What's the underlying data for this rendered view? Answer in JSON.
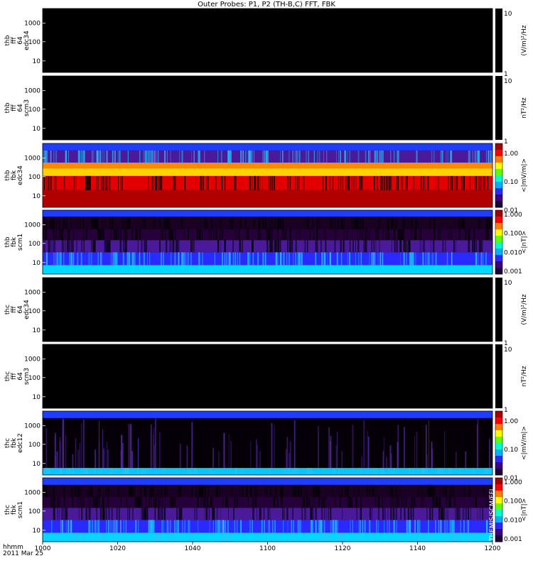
{
  "title": "Outer Probes: P1, P2 (TH-B,C) FFT, FBK",
  "time_axis": {
    "ticks": [
      "1000",
      "1020",
      "1040",
      "1100",
      "1120",
      "1140",
      "1200"
    ],
    "label_line1": "hhmm",
    "label_line2": "2011 Mar 25"
  },
  "freq_ticks": [
    "1000",
    "100",
    "10"
  ],
  "corner_note": "THEMIS/SCM/EFI",
  "colors": {
    "panel_empty": "#000000",
    "background": "#ffffff",
    "colorbar": [
      "#1a0033",
      "#3a0080",
      "#2a2aff",
      "#00b0ff",
      "#00ffd0",
      "#60ff00",
      "#ffff00",
      "#ff8000",
      "#ff0000",
      "#a00000"
    ]
  },
  "chart_data": [
    {
      "type": "heatmap",
      "panel_label": [
        "thb",
        "fff",
        "64",
        "edc34"
      ],
      "colorbar_label": "(V/m)²/Hz",
      "colorbar_ticks": [
        "10",
        "1"
      ],
      "colorbar_kind": "solid",
      "data_state": "empty",
      "bands": []
    },
    {
      "type": "heatmap",
      "panel_label": [
        "thb",
        "fff",
        "64",
        "scm3"
      ],
      "colorbar_label": "nT²/Hz",
      "colorbar_ticks": [
        "10",
        "1"
      ],
      "colorbar_kind": "solid",
      "data_state": "empty",
      "bands": []
    },
    {
      "type": "heatmap",
      "panel_label": [
        "thb",
        "fbk",
        "edc34"
      ],
      "colorbar_label": "<|mV/m|>",
      "colorbar_ticks": [
        "1.00",
        "0.10",
        "0.01"
      ],
      "colorbar_kind": "rainbow",
      "data_state": "filled",
      "bands": [
        {
          "from": 0.0,
          "to": 0.11,
          "color": "#1f3dff",
          "texture": "flat"
        },
        {
          "from": 0.11,
          "to": 0.3,
          "color": "#4a1a9a",
          "texture": "cyan-stripes"
        },
        {
          "from": 0.3,
          "to": 0.39,
          "color": "#ff8a00",
          "texture": "flat"
        },
        {
          "from": 0.39,
          "to": 0.51,
          "color": "#ffd400",
          "texture": "flat"
        },
        {
          "from": 0.51,
          "to": 0.73,
          "color": "#e30000",
          "texture": "dark-stripes"
        },
        {
          "from": 0.73,
          "to": 1.0,
          "color": "#b00000",
          "texture": "flat"
        }
      ]
    },
    {
      "type": "heatmap",
      "panel_label": [
        "thb",
        "fbk",
        "scm1"
      ],
      "colorbar_label": "<|nT|>",
      "colorbar_ticks": [
        "1.000",
        "0.100",
        "0.010",
        "0.001"
      ],
      "colorbar_kind": "rainbow",
      "data_state": "filled",
      "bands": [
        {
          "from": 0.0,
          "to": 0.1,
          "color": "#1f3dff",
          "texture": "flat"
        },
        {
          "from": 0.1,
          "to": 0.3,
          "color": "#1a0022",
          "texture": "dark-stripes"
        },
        {
          "from": 0.3,
          "to": 0.47,
          "color": "#260038",
          "texture": "dark-stripes"
        },
        {
          "from": 0.47,
          "to": 0.66,
          "color": "#4a1a9a",
          "texture": "dark-stripes"
        },
        {
          "from": 0.66,
          "to": 0.86,
          "color": "#2a2aff",
          "texture": "cyan-stripes"
        },
        {
          "from": 0.86,
          "to": 1.0,
          "color": "#00d8ff",
          "texture": "flat"
        }
      ]
    },
    {
      "type": "heatmap",
      "panel_label": [
        "thc",
        "fff",
        "64",
        "edc34"
      ],
      "colorbar_label": "(V/m)²/Hz",
      "colorbar_ticks": [
        "10",
        "1"
      ],
      "colorbar_kind": "solid",
      "data_state": "empty",
      "bands": []
    },
    {
      "type": "heatmap",
      "panel_label": [
        "thc",
        "fff",
        "64",
        "scm3"
      ],
      "colorbar_label": "nT²/Hz",
      "colorbar_ticks": [
        "10",
        "1"
      ],
      "colorbar_kind": "solid",
      "data_state": "empty",
      "bands": []
    },
    {
      "type": "heatmap",
      "panel_label": [
        "thc",
        "fbk",
        "edc12"
      ],
      "colorbar_label": "<|mV/m|>",
      "colorbar_ticks": [
        "1.00",
        "0.10",
        "0.01"
      ],
      "colorbar_kind": "rainbow",
      "data_state": "filled",
      "bands": [
        {
          "from": 0.0,
          "to": 0.11,
          "color": "#1f3dff",
          "texture": "flat"
        },
        {
          "from": 0.11,
          "to": 0.89,
          "color": "#050008",
          "texture": "purple-stripes"
        },
        {
          "from": 0.89,
          "to": 1.0,
          "color": "#00c8ff",
          "texture": "cyan-stripes"
        }
      ]
    },
    {
      "type": "heatmap",
      "panel_label": [
        "thc",
        "fbk",
        "scm1"
      ],
      "colorbar_label": "<|nT|>",
      "colorbar_ticks": [
        "1.000",
        "0.100",
        "0.010",
        "0.001"
      ],
      "colorbar_kind": "rainbow",
      "data_state": "filled",
      "bands": [
        {
          "from": 0.0,
          "to": 0.11,
          "color": "#1f3dff",
          "texture": "flat"
        },
        {
          "from": 0.11,
          "to": 0.3,
          "color": "#1a0022",
          "texture": "dark-stripes"
        },
        {
          "from": 0.3,
          "to": 0.47,
          "color": "#260038",
          "texture": "dark-stripes"
        },
        {
          "from": 0.47,
          "to": 0.66,
          "color": "#4a1a9a",
          "texture": "dark-stripes"
        },
        {
          "from": 0.66,
          "to": 0.86,
          "color": "#2a2aff",
          "texture": "cyan-stripes"
        },
        {
          "from": 0.86,
          "to": 1.0,
          "color": "#00d8ff",
          "texture": "cyan-stripes"
        }
      ]
    }
  ]
}
